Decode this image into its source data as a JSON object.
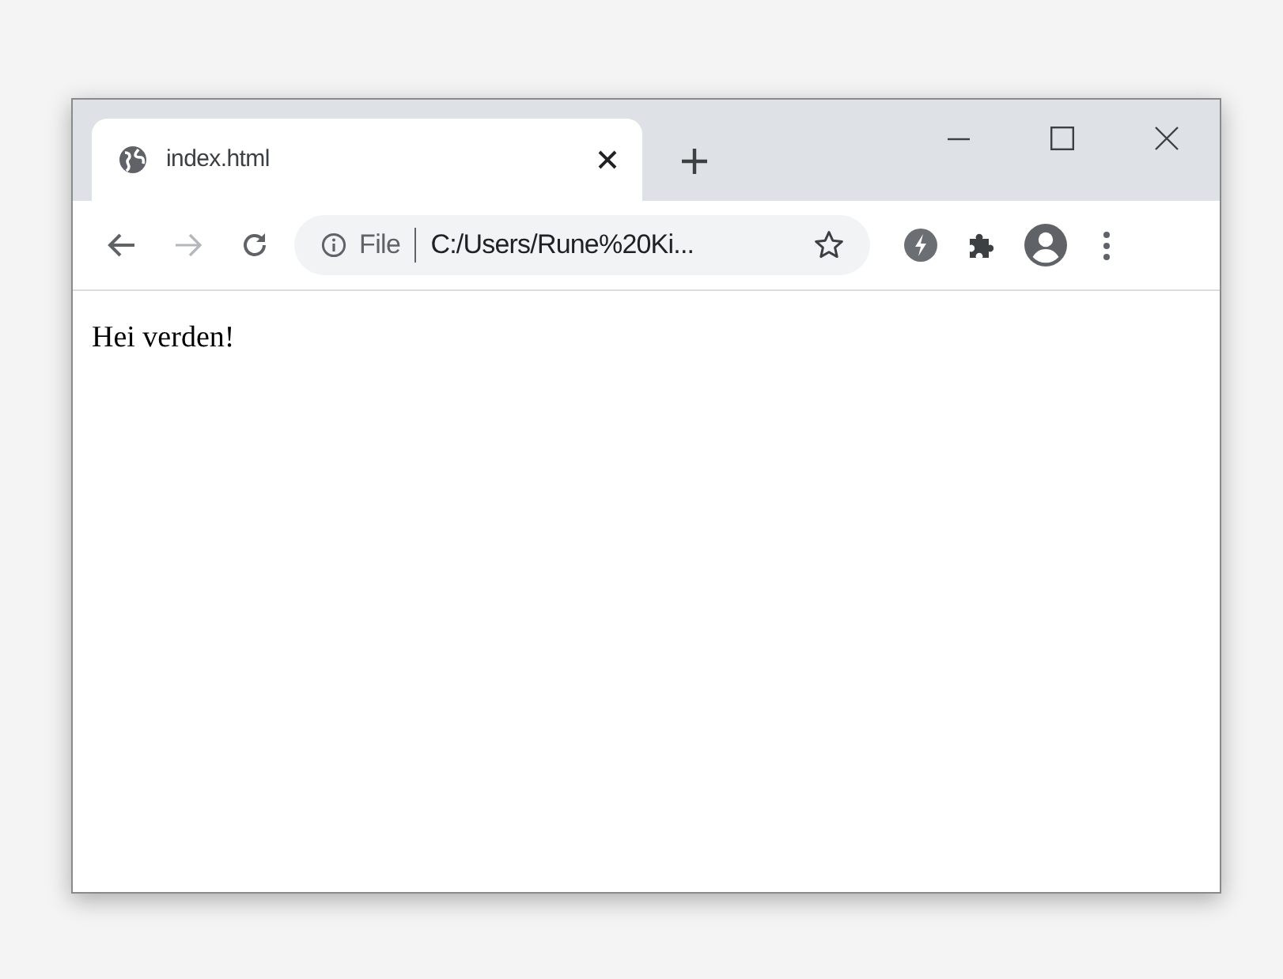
{
  "window": {
    "tabs": [
      {
        "title": "index.html",
        "selected": true
      }
    ]
  },
  "toolbar": {
    "address": {
      "scheme_label": "File",
      "url": "C:/Users/Rune%20Ki..."
    }
  },
  "page": {
    "text": "Hei verden!"
  }
}
